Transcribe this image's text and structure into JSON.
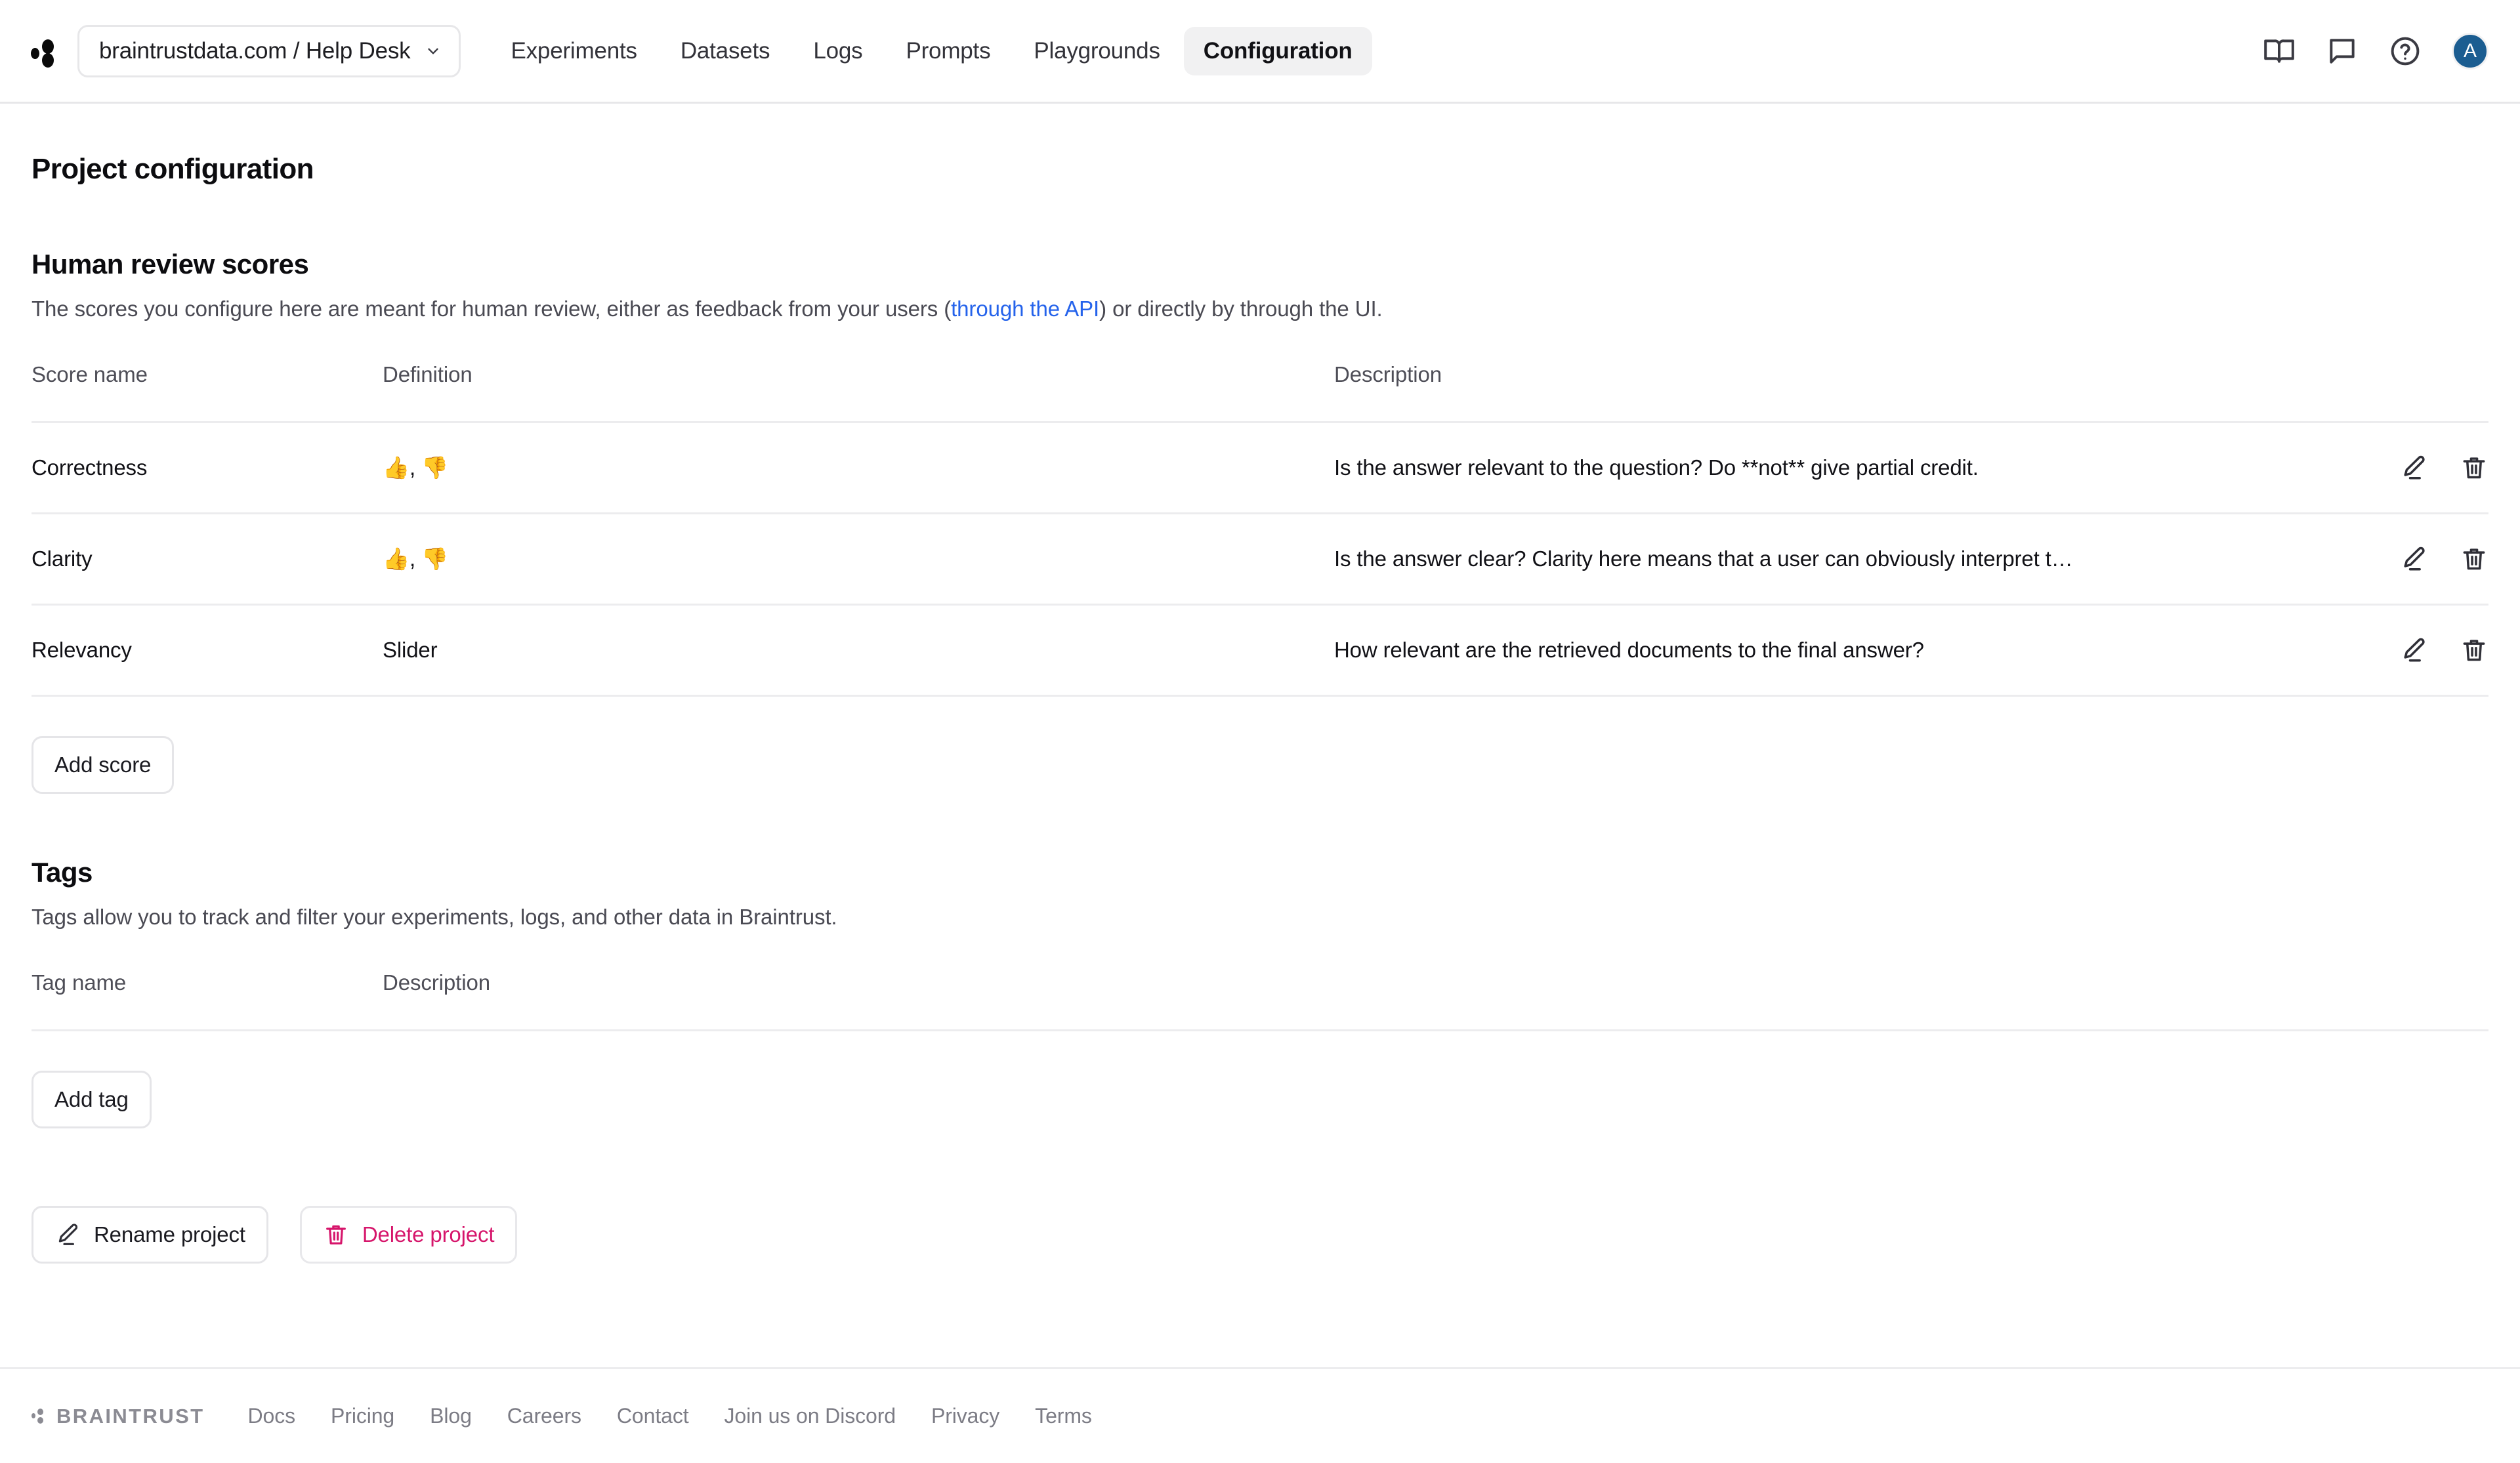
{
  "header": {
    "logo_icon": "braintrust-dots-logo",
    "project_selector": {
      "label": "braintrustdata.com / Help Desk",
      "chevron_icon": "chevron-down-icon"
    },
    "nav": [
      {
        "label": "Experiments",
        "active": false
      },
      {
        "label": "Datasets",
        "active": false
      },
      {
        "label": "Logs",
        "active": false
      },
      {
        "label": "Prompts",
        "active": false
      },
      {
        "label": "Playgrounds",
        "active": false
      },
      {
        "label": "Configuration",
        "active": true
      }
    ],
    "actions": [
      {
        "icon": "book-icon",
        "name": "docs-button"
      },
      {
        "icon": "chat-bubble-icon",
        "name": "feedback-button"
      },
      {
        "icon": "question-circle-icon",
        "name": "help-button"
      }
    ],
    "avatar": {
      "initial": "A",
      "color": "#1b5d91"
    }
  },
  "page": {
    "title": "Project configuration"
  },
  "human_review": {
    "title": "Human review scores",
    "desc_before": "The scores you configure here are meant for human review, either as feedback from your users (",
    "desc_link": "through the API",
    "desc_after": ") or directly by through the UI.",
    "columns": {
      "name": "Score name",
      "definition": "Definition",
      "description": "Description"
    },
    "rows": [
      {
        "name": "Correctness",
        "definition": "👍, 👎",
        "description": "Is the answer relevant to the question? Do **not** give partial credit.",
        "edit_icon": "pencil-icon",
        "delete_icon": "trash-icon"
      },
      {
        "name": "Clarity",
        "definition": "👍, 👎",
        "description": "Is the answer clear? Clarity here means that a user can obviously interpret t…",
        "edit_icon": "pencil-icon",
        "delete_icon": "trash-icon"
      },
      {
        "name": "Relevancy",
        "definition": "Slider",
        "description": "How relevant are the retrieved documents to the final answer?",
        "edit_icon": "pencil-icon",
        "delete_icon": "trash-icon"
      }
    ],
    "add_button": "Add score"
  },
  "tags": {
    "title": "Tags",
    "description": "Tags allow you to track and filter your experiments, logs, and other data in Braintrust.",
    "columns": {
      "name": "Tag name",
      "description": "Description"
    },
    "rows": [],
    "add_button": "Add tag"
  },
  "project_actions": {
    "rename_label": "Rename project",
    "rename_icon": "pencil-icon",
    "delete_label": "Delete project",
    "delete_icon": "trash-icon",
    "delete_color": "#d6156b"
  },
  "footer": {
    "brand": "BRAINTRUST",
    "links": [
      "Docs",
      "Pricing",
      "Blog",
      "Careers",
      "Contact",
      "Join us on Discord",
      "Privacy",
      "Terms"
    ]
  }
}
